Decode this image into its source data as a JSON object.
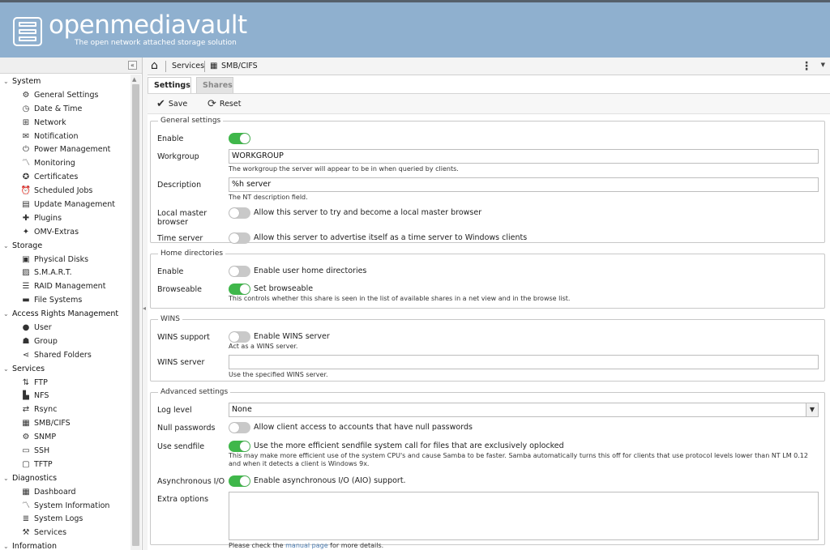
{
  "header": {
    "title": "openmediavault",
    "subtitle": "The open network attached storage solution"
  },
  "sidebar": {
    "collapse_label": "«",
    "tree": [
      {
        "type": "cat",
        "label": "System"
      },
      {
        "type": "item",
        "label": "General Settings",
        "icon": "gear-icon"
      },
      {
        "type": "item",
        "label": "Date & Time",
        "icon": "clock-icon"
      },
      {
        "type": "item",
        "label": "Network",
        "icon": "network-icon"
      },
      {
        "type": "item",
        "label": "Notification",
        "icon": "mail-icon"
      },
      {
        "type": "item",
        "label": "Power Management",
        "icon": "power-icon"
      },
      {
        "type": "item",
        "label": "Monitoring",
        "icon": "chart-line-icon"
      },
      {
        "type": "item",
        "label": "Certificates",
        "icon": "certificate-icon"
      },
      {
        "type": "item",
        "label": "Scheduled Jobs",
        "icon": "alarm-icon"
      },
      {
        "type": "item",
        "label": "Update Management",
        "icon": "update-icon"
      },
      {
        "type": "item",
        "label": "Plugins",
        "icon": "puzzle-icon"
      },
      {
        "type": "item",
        "label": "OMV-Extras",
        "icon": "wand-icon"
      },
      {
        "type": "cat",
        "label": "Storage"
      },
      {
        "type": "item",
        "label": "Physical Disks",
        "icon": "disk-icon"
      },
      {
        "type": "item",
        "label": "S.M.A.R.T.",
        "icon": "smart-icon"
      },
      {
        "type": "item",
        "label": "RAID Management",
        "icon": "raid-icon"
      },
      {
        "type": "item",
        "label": "File Systems",
        "icon": "folder-icon"
      },
      {
        "type": "cat",
        "label": "Access Rights Management"
      },
      {
        "type": "item",
        "label": "User",
        "icon": "user-icon"
      },
      {
        "type": "item",
        "label": "Group",
        "icon": "group-icon"
      },
      {
        "type": "item",
        "label": "Shared Folders",
        "icon": "share-icon"
      },
      {
        "type": "cat",
        "label": "Services"
      },
      {
        "type": "item",
        "label": "FTP",
        "icon": "ftp-icon"
      },
      {
        "type": "item",
        "label": "NFS",
        "icon": "nfs-icon"
      },
      {
        "type": "item",
        "label": "Rsync",
        "icon": "rsync-icon"
      },
      {
        "type": "item",
        "label": "SMB/CIFS",
        "icon": "windows-icon"
      },
      {
        "type": "item",
        "label": "SNMP",
        "icon": "snmp-icon"
      },
      {
        "type": "item",
        "label": "SSH",
        "icon": "terminal-icon"
      },
      {
        "type": "item",
        "label": "TFTP",
        "icon": "monitor-icon"
      },
      {
        "type": "cat",
        "label": "Diagnostics"
      },
      {
        "type": "item",
        "label": "Dashboard",
        "icon": "dashboard-icon"
      },
      {
        "type": "item",
        "label": "System Information",
        "icon": "chart-line-icon"
      },
      {
        "type": "item",
        "label": "System Logs",
        "icon": "logs-icon"
      },
      {
        "type": "item",
        "label": "Services",
        "icon": "wrench-icon"
      },
      {
        "type": "cat",
        "label": "Information"
      }
    ]
  },
  "breadcrumb": {
    "services": "Services",
    "smb": "SMB/CIFS"
  },
  "tabs": {
    "settings": "Settings",
    "shares": "Shares"
  },
  "toolbar": {
    "save": "Save",
    "reset": "Reset"
  },
  "general": {
    "legend": "General settings",
    "enable_label": "Enable",
    "enable_on": true,
    "workgroup_label": "Workgroup",
    "workgroup_value": "WORKGROUP",
    "workgroup_hint": "The workgroup the server will appear to be in when queried by clients.",
    "description_label": "Description",
    "description_value": "%h server",
    "description_hint": "The NT description field.",
    "lmb_label_1": "Local master",
    "lmb_label_2": "browser",
    "lmb_text": "Allow this server to try and become a local master browser",
    "timeserver_label": "Time server",
    "timeserver_text": "Allow this server to advertise itself as a time server to Windows clients"
  },
  "home": {
    "legend": "Home directories",
    "enable_label": "Enable",
    "enable_text": "Enable user home directories",
    "browse_label": "Browseable",
    "browse_text": "Set browseable",
    "browse_hint": "This controls whether this share is seen in the list of available shares in a net view and in the browse list."
  },
  "wins": {
    "legend": "WINS",
    "support_label": "WINS support",
    "support_text": "Enable WINS server",
    "support_hint": "Act as a WINS server.",
    "server_label": "WINS server",
    "server_value": "",
    "server_hint": "Use the specified WINS server."
  },
  "advanced": {
    "legend": "Advanced settings",
    "loglevel_label": "Log level",
    "loglevel_value": "None",
    "nullpw_label": "Null passwords",
    "nullpw_text": "Allow client access to accounts that have null passwords",
    "sendfile_label": "Use sendfile",
    "sendfile_text": "Use the more efficient sendfile system call for files that are exclusively oplocked",
    "sendfile_hint": "This may make more efficient use of the system CPU's and cause Samba to be faster. Samba automatically turns this off for clients that use protocol levels lower than NT LM 0.12 and when it detects a client is Windows 9x.",
    "aio_label": "Asynchronous I/O",
    "aio_text": "Enable asynchronous I/O (AIO) support.",
    "extra_label": "Extra options",
    "extra_hint_pre": "Please check the ",
    "extra_hint_link": "manual page",
    "extra_hint_post": " for more details."
  }
}
